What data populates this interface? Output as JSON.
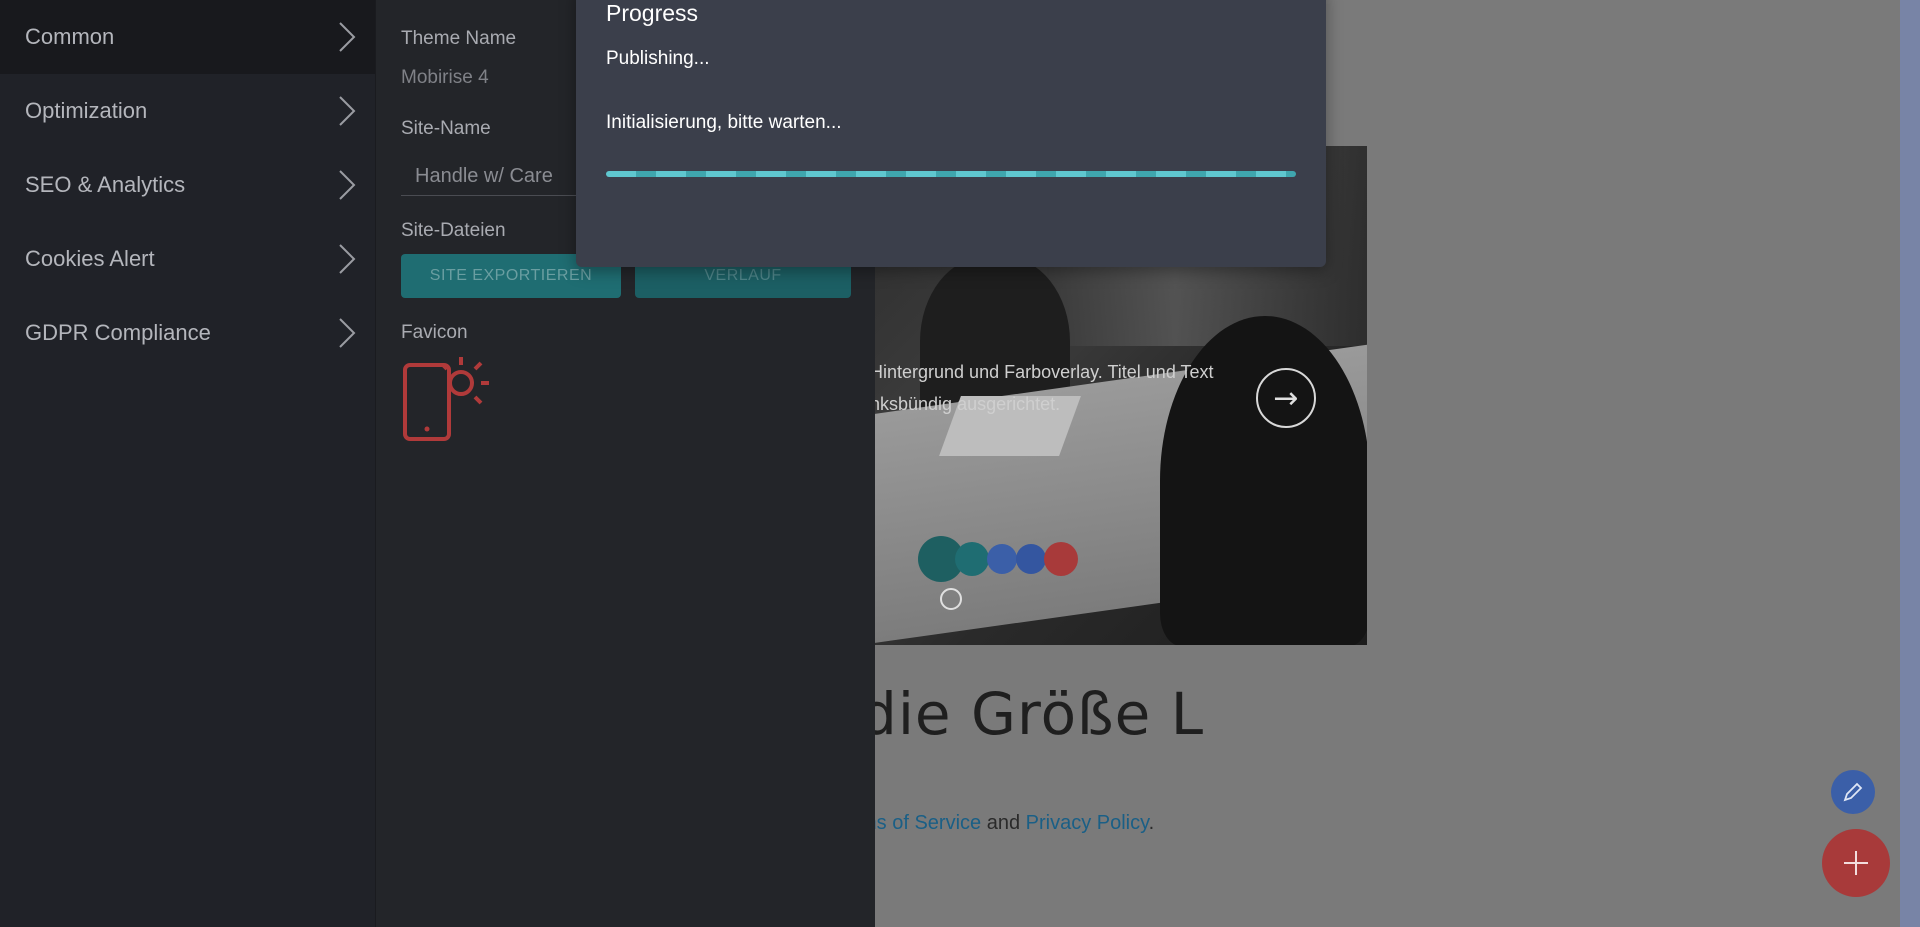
{
  "nav": {
    "items": [
      {
        "label": "Common",
        "active": true
      },
      {
        "label": "Optimization",
        "active": false
      },
      {
        "label": "SEO & Analytics",
        "active": false
      },
      {
        "label": "Cookies Alert",
        "active": false
      },
      {
        "label": "GDPR Compliance",
        "active": false
      }
    ]
  },
  "settings": {
    "theme_name_label": "Theme Name",
    "theme_name_value": "Mobirise 4",
    "site_name_label": "Site-Name",
    "site_name_value": "Handle w/ Care",
    "site_files_label": "Site-Dateien",
    "export_button": "SITE EXPORTIEREN",
    "history_button": "VERLAUF",
    "favicon_label": "Favicon"
  },
  "preview": {
    "hero_text_line1": "Hintergrund und Farboverlay. Titel und Text",
    "hero_text_line2": "nksbündig ausgerichtet.",
    "heading": "die Größe L",
    "terms_prefix": "ms of Service",
    "terms_and": " and ",
    "terms_privacy": "Privacy Policy",
    "terms_suffix": "."
  },
  "modal": {
    "title": "Progress",
    "status": "Publishing...",
    "message": "Initialisierung, bitte warten...",
    "progress": 1.0
  },
  "icons": {
    "favicon": "phone-sun-icon",
    "nav_chevron": "chevron-right-icon",
    "hero_arrow": "arrow-right-circle-icon",
    "edit": "pencil-icon",
    "add": "plus-icon"
  },
  "colors": {
    "accent_teal": "#1f6d72",
    "favicon_red": "#b03a3a",
    "fab_add": "#a83a3a",
    "fab_edit": "#3b5fa8",
    "loader": [
      "#1e5f61",
      "#1f6d72",
      "#3b5fa8",
      "#3456a0",
      "#a83a3a"
    ]
  }
}
